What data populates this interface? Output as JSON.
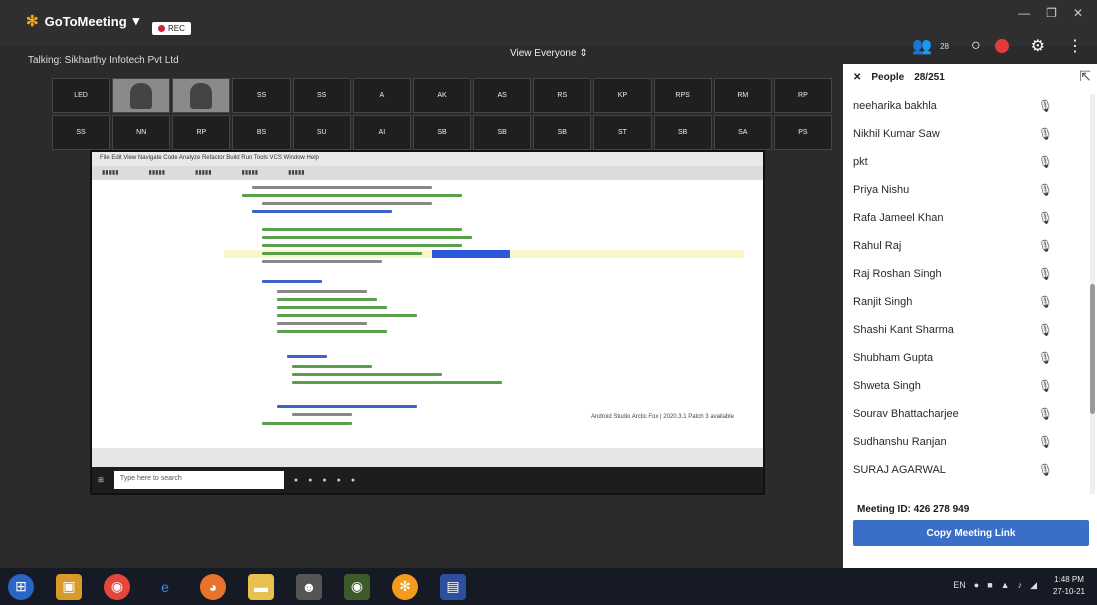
{
  "app": {
    "brand": "GoToMeeting",
    "rec_label": "REC",
    "talking": "Talking: Sikharthy Infotech Pvt Ltd",
    "view_label": "View Everyone",
    "people_badge": "28"
  },
  "thumbnails": [
    "LED",
    "",
    "",
    "SS",
    "SS",
    "A",
    "AK",
    "AS",
    "RS",
    "KP",
    "RPS",
    "RM",
    "RP",
    "SS",
    "NN",
    "RP",
    "BS",
    "SU",
    "AI",
    "SB",
    "SB",
    "SB",
    "ST",
    "SB",
    "SA",
    "PS"
  ],
  "ide": {
    "menu": "File  Edit  View  Navigate  Code  Analyze  Refactor  Build  Run  Tools  VCS  Window  Help",
    "toast": "Android Studio Arctic Fox | 2020.3.1 Patch 3 available",
    "taskbar_search": "Type here to search"
  },
  "people_panel": {
    "title": "People",
    "count": "28/251",
    "participants": [
      "neeharika bakhla",
      "Nikhil Kumar Saw",
      "pkt",
      "Priya Nishu",
      "Rafa Jameel Khan",
      "Rahul Raj",
      "Raj Roshan Singh",
      "Ranjit Singh",
      "Shashi Kant Sharma",
      "Shubham Gupta",
      "Shweta Singh",
      "Sourav Bhattacharjee",
      "Sudhanshu Ranjan",
      "SURAJ AGARWAL"
    ],
    "meeting_id_label": "Meeting ID:",
    "meeting_id": "426 278 949",
    "copy_link_label": "Copy Meeting Link"
  },
  "system": {
    "language": "EN",
    "time": "1:48 PM",
    "date": "27-10-21"
  },
  "colors": {
    "accent": "#3b6fc7",
    "rec": "#d3202f",
    "brand_star": "#f6a21a"
  }
}
